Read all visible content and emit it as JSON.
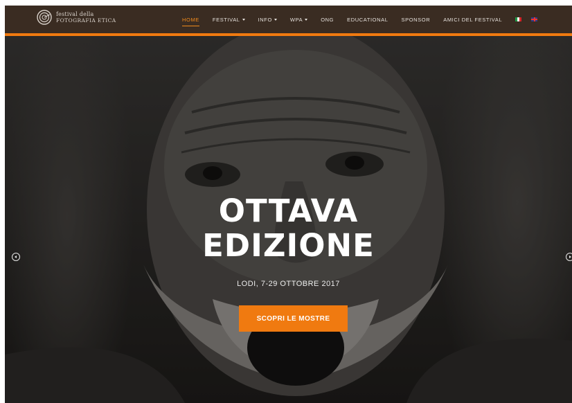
{
  "colors": {
    "accent": "#f07a10",
    "nav_background": "#3a2c22",
    "nav_active": "#f08a1c"
  },
  "logo": {
    "line1": "festival della",
    "line2": "FOTOGRAFIA ETICA"
  },
  "nav": {
    "items": [
      {
        "label": "HOME",
        "active": true,
        "dropdown": false
      },
      {
        "label": "FESTIVAL",
        "active": false,
        "dropdown": true
      },
      {
        "label": "INFO",
        "active": false,
        "dropdown": true
      },
      {
        "label": "WPA",
        "active": false,
        "dropdown": true
      },
      {
        "label": "ONG",
        "active": false,
        "dropdown": false
      },
      {
        "label": "EDUCATIONAL",
        "active": false,
        "dropdown": false
      },
      {
        "label": "SPONSOR",
        "active": false,
        "dropdown": false
      },
      {
        "label": "AMICI DEL FESTIVAL",
        "active": false,
        "dropdown": false
      }
    ],
    "languages": [
      "flag-it-icon",
      "flag-uk-icon"
    ]
  },
  "hero": {
    "title_line1": "OTTAVA",
    "title_line2": "EDIZIONE",
    "subtitle": "LODI, 7-29 OTTOBRE 2017",
    "cta_label": "SCOPRI LE MOSTRE",
    "prev_icon": "circle-arrow-left-icon",
    "next_icon": "circle-arrow-right-icon"
  }
}
